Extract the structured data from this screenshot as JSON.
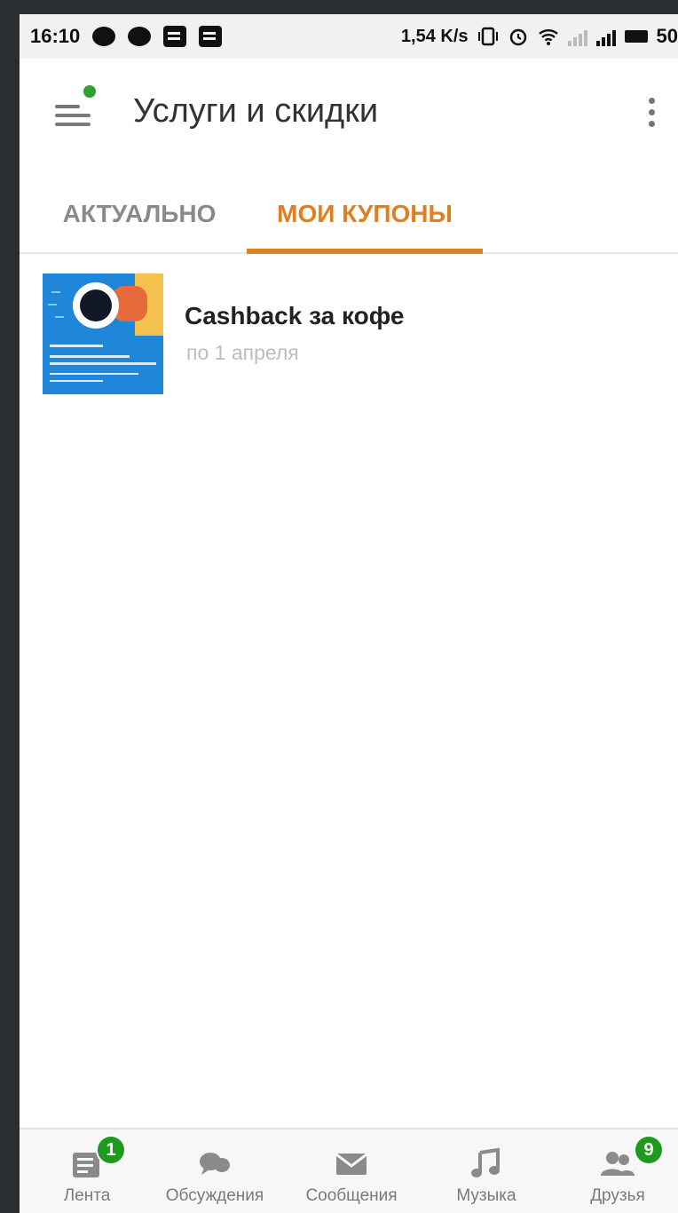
{
  "status_bar": {
    "time": "16:10",
    "net_speed": "1,54 K/s",
    "battery": "50",
    "icons_left": [
      "chat-bubble-icon",
      "message-icon",
      "mail-image-icon",
      "telegram-icon"
    ],
    "icons_right": [
      "vibrate-icon",
      "alarm-icon",
      "wifi-icon",
      "signal-icon",
      "signal-icon",
      "battery-icon"
    ]
  },
  "app_bar": {
    "title": "Услуги и скидки",
    "menu_icon": "hamburger-icon",
    "menu_notification_color": "#2fa12f",
    "more_icon": "more-vert-icon"
  },
  "tabs": [
    {
      "label": "АКТУАЛЬНО",
      "active": false
    },
    {
      "label": "МОИ КУПОНЫ",
      "active": true
    }
  ],
  "accent_color": "#e07f1f",
  "coupons": [
    {
      "title": "Cashback за кофе",
      "subtitle": "по 1 апреля"
    }
  ],
  "bottom_nav": [
    {
      "label": "Лента",
      "icon": "feed-icon",
      "badge": "1"
    },
    {
      "label": "Обсуждения",
      "icon": "discussions-icon",
      "badge": ""
    },
    {
      "label": "Сообщения",
      "icon": "messages-icon",
      "badge": ""
    },
    {
      "label": "Музыка",
      "icon": "music-icon",
      "badge": ""
    },
    {
      "label": "Друзья",
      "icon": "friends-icon",
      "badge": "9"
    }
  ]
}
